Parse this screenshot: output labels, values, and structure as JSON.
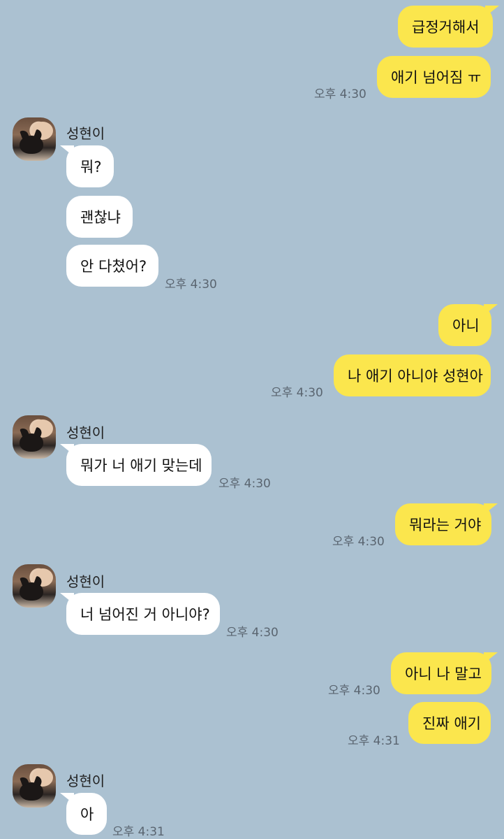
{
  "contact_name": "성현이",
  "messages": {
    "m1": "급정거해서",
    "m2": "애기 넘어짐 ㅠ",
    "t2": "오후 4:30",
    "m3": "뭐?",
    "m4": "괜찮냐",
    "m5": "안 다쳤어?",
    "t5": "오후 4:30",
    "m6": "아니",
    "m7": "나 애기 아니야 성현아",
    "t7": "오후 4:30",
    "m8": "뭐가 너 애기 맞는데",
    "t8": "오후 4:30",
    "m9": "뭐라는 거야",
    "t9": "오후 4:30",
    "m10": "너 넘어진 거 아니야?",
    "t10": "오후 4:30",
    "m11": "아니 나 말고",
    "t11": "오후 4:30",
    "m12": "진짜 애기",
    "t12": "오후 4:31",
    "m13": "아",
    "t13": "오후 4:31"
  },
  "colors": {
    "background": "#abc1d1",
    "my_bubble": "#fbe64d",
    "their_bubble": "#ffffff"
  },
  "icons": {
    "avatar": "profile-photo"
  }
}
